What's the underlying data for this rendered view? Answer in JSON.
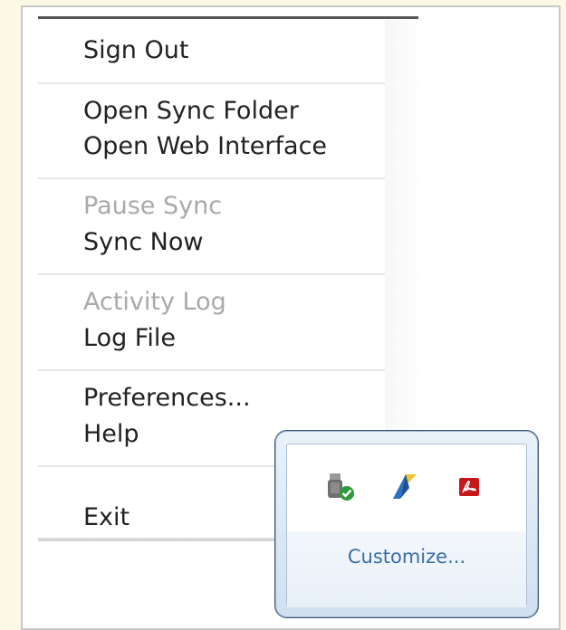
{
  "context_menu": {
    "groups": [
      {
        "items": [
          {
            "label": "Sign Out",
            "enabled": true
          }
        ]
      },
      {
        "items": [
          {
            "label": "Open Sync Folder",
            "enabled": true
          },
          {
            "label": "Open Web Interface",
            "enabled": true
          }
        ]
      },
      {
        "items": [
          {
            "label": "Pause Sync",
            "enabled": false
          },
          {
            "label": "Sync Now",
            "enabled": true
          }
        ]
      },
      {
        "items": [
          {
            "label": "Activity Log",
            "enabled": false
          },
          {
            "label": "Log File",
            "enabled": true
          }
        ]
      },
      {
        "items": [
          {
            "label": "Preferences...",
            "enabled": true
          },
          {
            "label": "Help",
            "enabled": true
          }
        ]
      },
      {
        "items": [
          {
            "label": "Exit",
            "enabled": true
          }
        ]
      }
    ]
  },
  "tray_popup": {
    "icons": [
      {
        "name": "sync-client-check-icon"
      },
      {
        "name": "blue-yellow-app-icon"
      },
      {
        "name": "pdf-reader-icon"
      }
    ],
    "customize_label": "Customize..."
  },
  "colors": {
    "page_background": "#fbf8e6",
    "menu_text": "#222222",
    "disabled_text": "#a9a9a9",
    "link": "#3a6ea5"
  }
}
